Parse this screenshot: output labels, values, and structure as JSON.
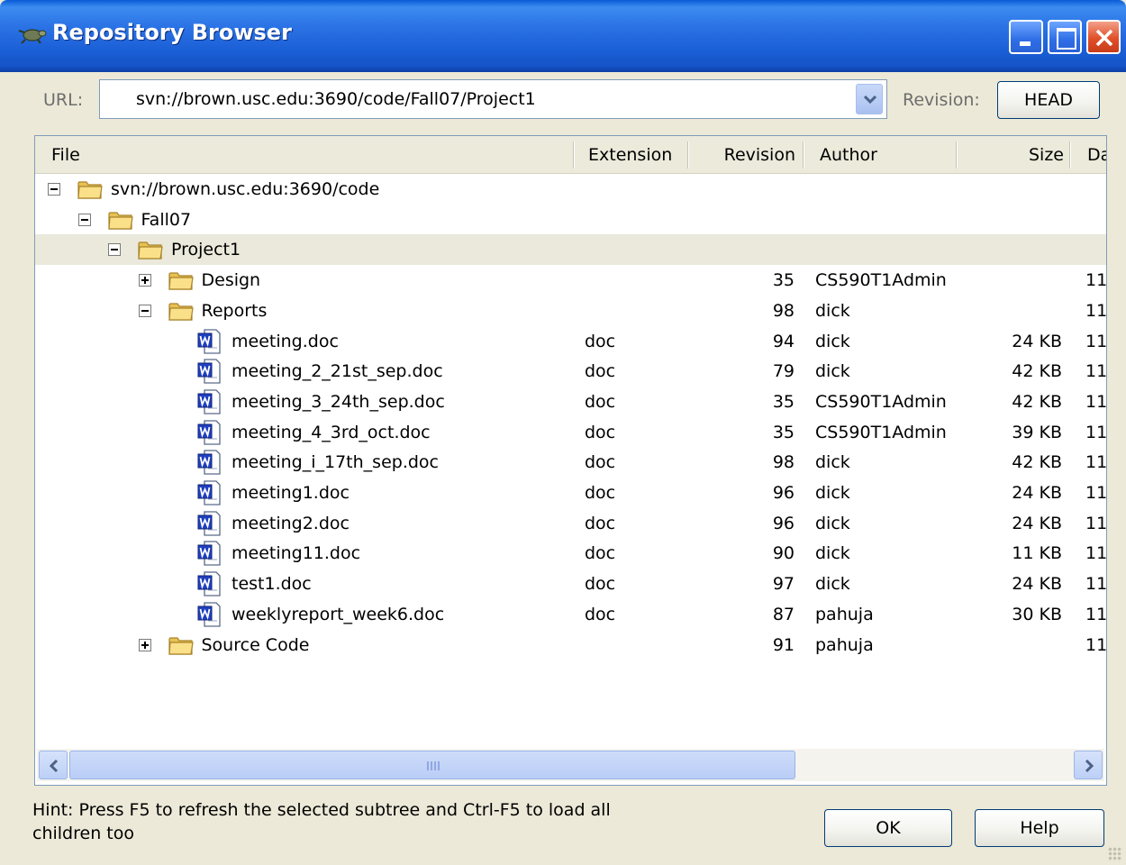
{
  "window": {
    "title": "Repository Browser",
    "icon": "turtle-icon"
  },
  "toolbar": {
    "url_label": "URL:",
    "url_value": "svn://brown.usc.edu:3690/code/Fall07/Project1",
    "revision_label": "Revision:",
    "revision_button": "HEAD"
  },
  "columns": {
    "file": "File",
    "extension": "Extension",
    "revision": "Revision",
    "author": "Author",
    "size": "Size",
    "date": "Da"
  },
  "rows": [
    {
      "name": "svn://brown.usc.edu:3690/code",
      "type": "folder",
      "depth": 0,
      "expander": "minus",
      "ext": "",
      "rev": "",
      "author": "",
      "size": "",
      "date": ""
    },
    {
      "name": "Fall07",
      "type": "folder",
      "depth": 1,
      "expander": "minus",
      "ext": "",
      "rev": "",
      "author": "",
      "size": "",
      "date": ""
    },
    {
      "name": "Project1",
      "type": "folder",
      "depth": 2,
      "expander": "minus",
      "ext": "",
      "rev": "",
      "author": "",
      "size": "",
      "date": "",
      "selected": true
    },
    {
      "name": "Design",
      "type": "folder",
      "depth": 3,
      "expander": "plus",
      "ext": "",
      "rev": "35",
      "author": "CS590T1Admin",
      "size": "",
      "date": "11"
    },
    {
      "name": "Reports",
      "type": "folder",
      "depth": 3,
      "expander": "minus",
      "ext": "",
      "rev": "98",
      "author": "dick",
      "size": "",
      "date": "11"
    },
    {
      "name": "meeting.doc",
      "type": "doc",
      "depth": 4,
      "ext": "doc",
      "rev": "94",
      "author": "dick",
      "size": "24 KB",
      "date": "11"
    },
    {
      "name": "meeting_2_21st_sep.doc",
      "type": "doc",
      "depth": 4,
      "ext": "doc",
      "rev": "79",
      "author": "dick",
      "size": "42 KB",
      "date": "11"
    },
    {
      "name": "meeting_3_24th_sep.doc",
      "type": "doc",
      "depth": 4,
      "ext": "doc",
      "rev": "35",
      "author": "CS590T1Admin",
      "size": "42 KB",
      "date": "11"
    },
    {
      "name": "meeting_4_3rd_oct.doc",
      "type": "doc",
      "depth": 4,
      "ext": "doc",
      "rev": "35",
      "author": "CS590T1Admin",
      "size": "39 KB",
      "date": "11"
    },
    {
      "name": "meeting_i_17th_sep.doc",
      "type": "doc",
      "depth": 4,
      "ext": "doc",
      "rev": "98",
      "author": "dick",
      "size": "42 KB",
      "date": "11"
    },
    {
      "name": "meeting1.doc",
      "type": "doc",
      "depth": 4,
      "ext": "doc",
      "rev": "96",
      "author": "dick",
      "size": "24 KB",
      "date": "11"
    },
    {
      "name": "meeting2.doc",
      "type": "doc",
      "depth": 4,
      "ext": "doc",
      "rev": "96",
      "author": "dick",
      "size": "24 KB",
      "date": "11"
    },
    {
      "name": "meeting11.doc",
      "type": "doc",
      "depth": 4,
      "ext": "doc",
      "rev": "90",
      "author": "dick",
      "size": "11 KB",
      "date": "11"
    },
    {
      "name": "test1.doc",
      "type": "doc",
      "depth": 4,
      "ext": "doc",
      "rev": "97",
      "author": "dick",
      "size": "24 KB",
      "date": "11"
    },
    {
      "name": "weeklyreport_week6.doc",
      "type": "doc",
      "depth": 4,
      "ext": "doc",
      "rev": "87",
      "author": "pahuja",
      "size": "30 KB",
      "date": "11"
    },
    {
      "name": "Source Code",
      "type": "folder",
      "depth": 3,
      "expander": "plus",
      "ext": "",
      "rev": "91",
      "author": "pahuja",
      "size": "",
      "date": "11"
    }
  ],
  "footer": {
    "hint": "Hint: Press F5 to refresh the selected subtree and Ctrl-F5 to load all children too",
    "ok_button": "OK",
    "help_button": "Help"
  },
  "colors": {
    "titlebar": "#1b5fd6",
    "selected_row": "#ebe9db",
    "folder_yellow": "#f6d86a",
    "word_blue": "#1f3fbf"
  }
}
